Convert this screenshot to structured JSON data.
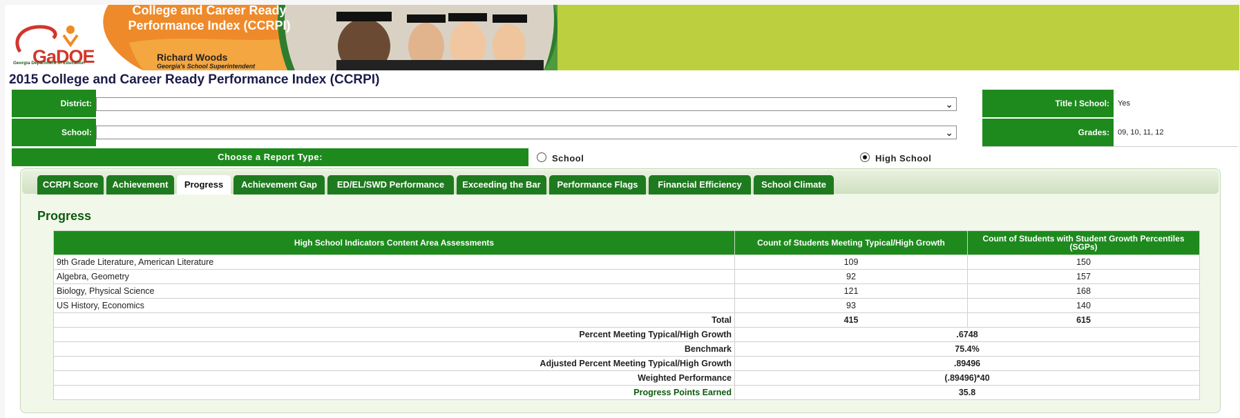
{
  "banner": {
    "logo_text": "GaDOE",
    "logo_subtitle": "Georgia Department of Education",
    "title_line1": "College and Career Ready",
    "title_line2": "Performance Index (CCRPI)",
    "superintendent_name": "Richard Woods",
    "superintendent_title": "Georgia's School Superintendent"
  },
  "page_title": "2015 College and Career Ready Performance Index (CCRPI)",
  "filters": {
    "district_label": "District:",
    "district_value": "",
    "school_label": "School:",
    "school_value": "",
    "title1_label": "Title I School:",
    "title1_value": "Yes",
    "grades_label": "Grades:",
    "grades_value": "09, 10, 11, 12"
  },
  "report_type": {
    "label": "Choose a Report Type:",
    "options": [
      "School",
      "High School"
    ],
    "selected": "High School"
  },
  "tabs": [
    "CCRPI Score",
    "Achievement",
    "Progress",
    "Achievement Gap",
    "ED/EL/SWD Performance",
    "Exceeding the Bar",
    "Performance Flags",
    "Financial Efficiency",
    "School Climate"
  ],
  "active_tab": "Progress",
  "section_title": "Progress",
  "table": {
    "headers": [
      "High School Indicators Content Area Assessments",
      "Count of Students Meeting Typical/High Growth",
      "Count of Students with Student Growth Percentiles (SGPs)"
    ],
    "rows": [
      [
        "9th Grade Literature, American Literature",
        "109",
        "150"
      ],
      [
        "Algebra, Geometry",
        "92",
        "157"
      ],
      [
        "Biology, Physical Science",
        "121",
        "168"
      ],
      [
        "US History, Economics",
        "93",
        "140"
      ]
    ],
    "total": {
      "label": "Total",
      "col1": "415",
      "col2": "615"
    },
    "summary": [
      {
        "label": "Percent Meeting Typical/High Growth",
        "value": ".6748"
      },
      {
        "label": "Benchmark",
        "value": "75.4%"
      },
      {
        "label": "Adjusted Percent Meeting Typical/High Growth",
        "value": ".89496"
      },
      {
        "label": "Weighted Performance",
        "value": "(.89496)*40"
      },
      {
        "label": "Progress Points Earned",
        "value": "35.8"
      }
    ]
  },
  "colors": {
    "header_green": "#1e8a1e",
    "banner_lime": "#bccf3f",
    "title_navy": "#1b1b4a"
  }
}
